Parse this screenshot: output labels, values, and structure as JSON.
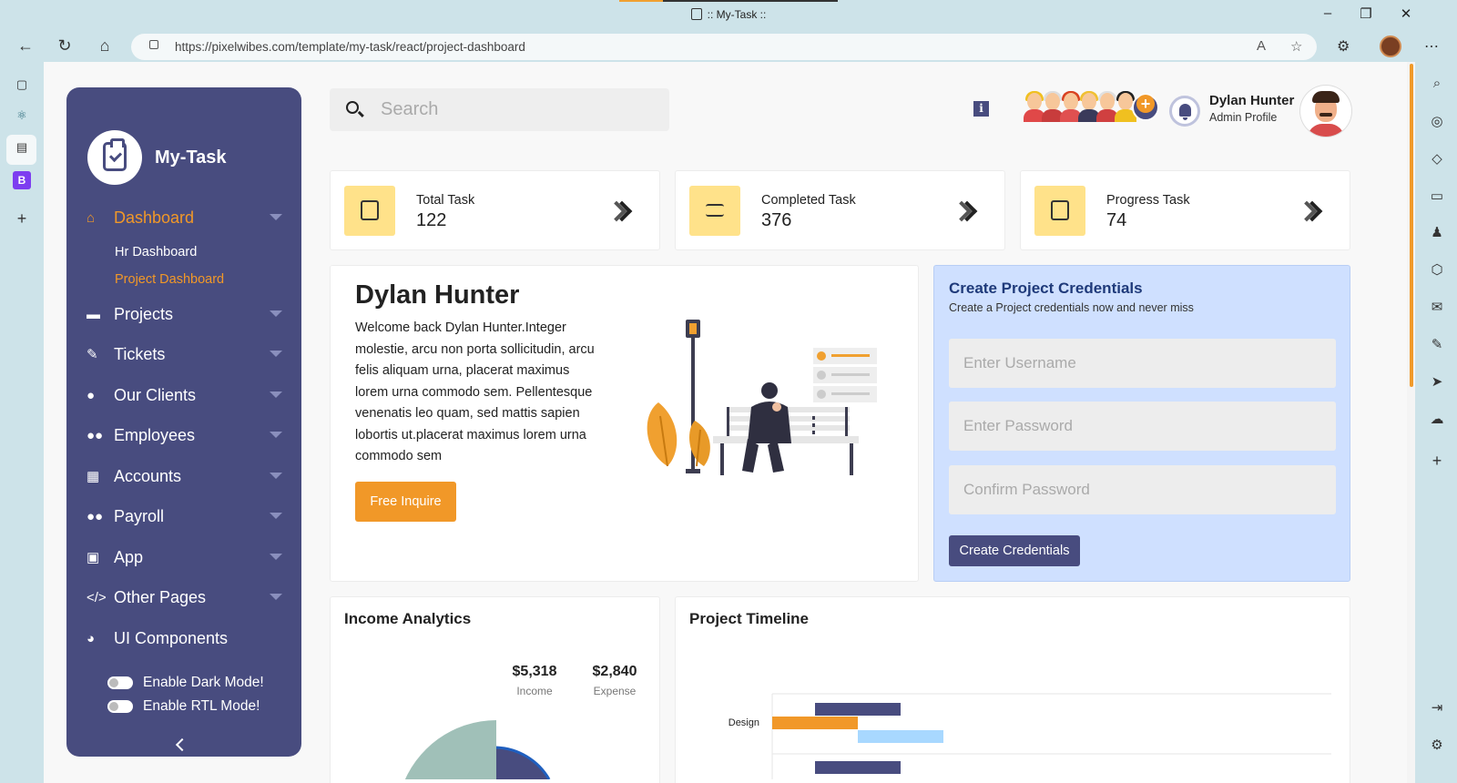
{
  "browser": {
    "window_title": ":: My-Task ::",
    "url": "https://pixelwibes.com/template/my-task/react/project-dashboard",
    "window_controls": [
      "minimize-icon",
      "restore-icon",
      "close-icon"
    ]
  },
  "sidebar": {
    "brand": "My-Task",
    "menu": [
      {
        "label": "Dashboard",
        "icon": "home-icon",
        "active": true
      },
      {
        "label": "Projects",
        "icon": "briefcase-icon"
      },
      {
        "label": "Tickets",
        "icon": "ticket-icon"
      },
      {
        "label": "Our Clients",
        "icon": "user-icon"
      },
      {
        "label": "Employees",
        "icon": "users-icon"
      },
      {
        "label": "Accounts",
        "icon": "calculator-icon"
      },
      {
        "label": "Payroll",
        "icon": "users-icon"
      },
      {
        "label": "App",
        "icon": "app-icon"
      },
      {
        "label": "Other Pages",
        "icon": "code-icon"
      },
      {
        "label": "UI Components",
        "icon": "palette-icon"
      }
    ],
    "submenu": [
      {
        "label": "Hr Dashboard"
      },
      {
        "label": "Project Dashboard",
        "active": true
      }
    ],
    "toggles": [
      {
        "label": "Enable Dark Mode!",
        "on": false
      },
      {
        "label": "Enable RTL Mode!",
        "on": false
      }
    ]
  },
  "header": {
    "search_placeholder": "Search",
    "user_name": "Dylan Hunter",
    "user_role": "Admin Profile"
  },
  "stats": [
    {
      "label": "Total Task",
      "value": "122"
    },
    {
      "label": "Completed Task",
      "value": "376"
    },
    {
      "label": "Progress Task",
      "value": "74"
    }
  ],
  "welcome": {
    "name": "Dylan Hunter",
    "text": "Welcome back Dylan Hunter.Integer molestie, arcu non porta sollicitudin, arcu felis aliquam urna, placerat maximus lorem urna commodo sem. Pellentesque venenatis leo quam, sed mattis sapien lobortis ut.placerat maximus lorem urna commodo sem",
    "button": "Free Inquire"
  },
  "credentials": {
    "title": "Create Project Credentials",
    "subtitle": "Create a Project credentials now and never miss",
    "username_placeholder": "Enter Username",
    "password_placeholder": "Enter Password",
    "confirm_placeholder": "Confirm Password",
    "button": "Create Credentials"
  },
  "income": {
    "title": "Income Analytics",
    "income_value": "$5,318",
    "income_label": "Income",
    "expense_value": "$2,840",
    "expense_label": "Expense"
  },
  "timeline": {
    "title": "Project Timeline",
    "row_label": "Design"
  },
  "colors": {
    "sidebar": "#484c7f",
    "accent": "#f19828",
    "stat_icon_bg": "#ffe28a",
    "credential_bg": "#cfe0ff"
  }
}
